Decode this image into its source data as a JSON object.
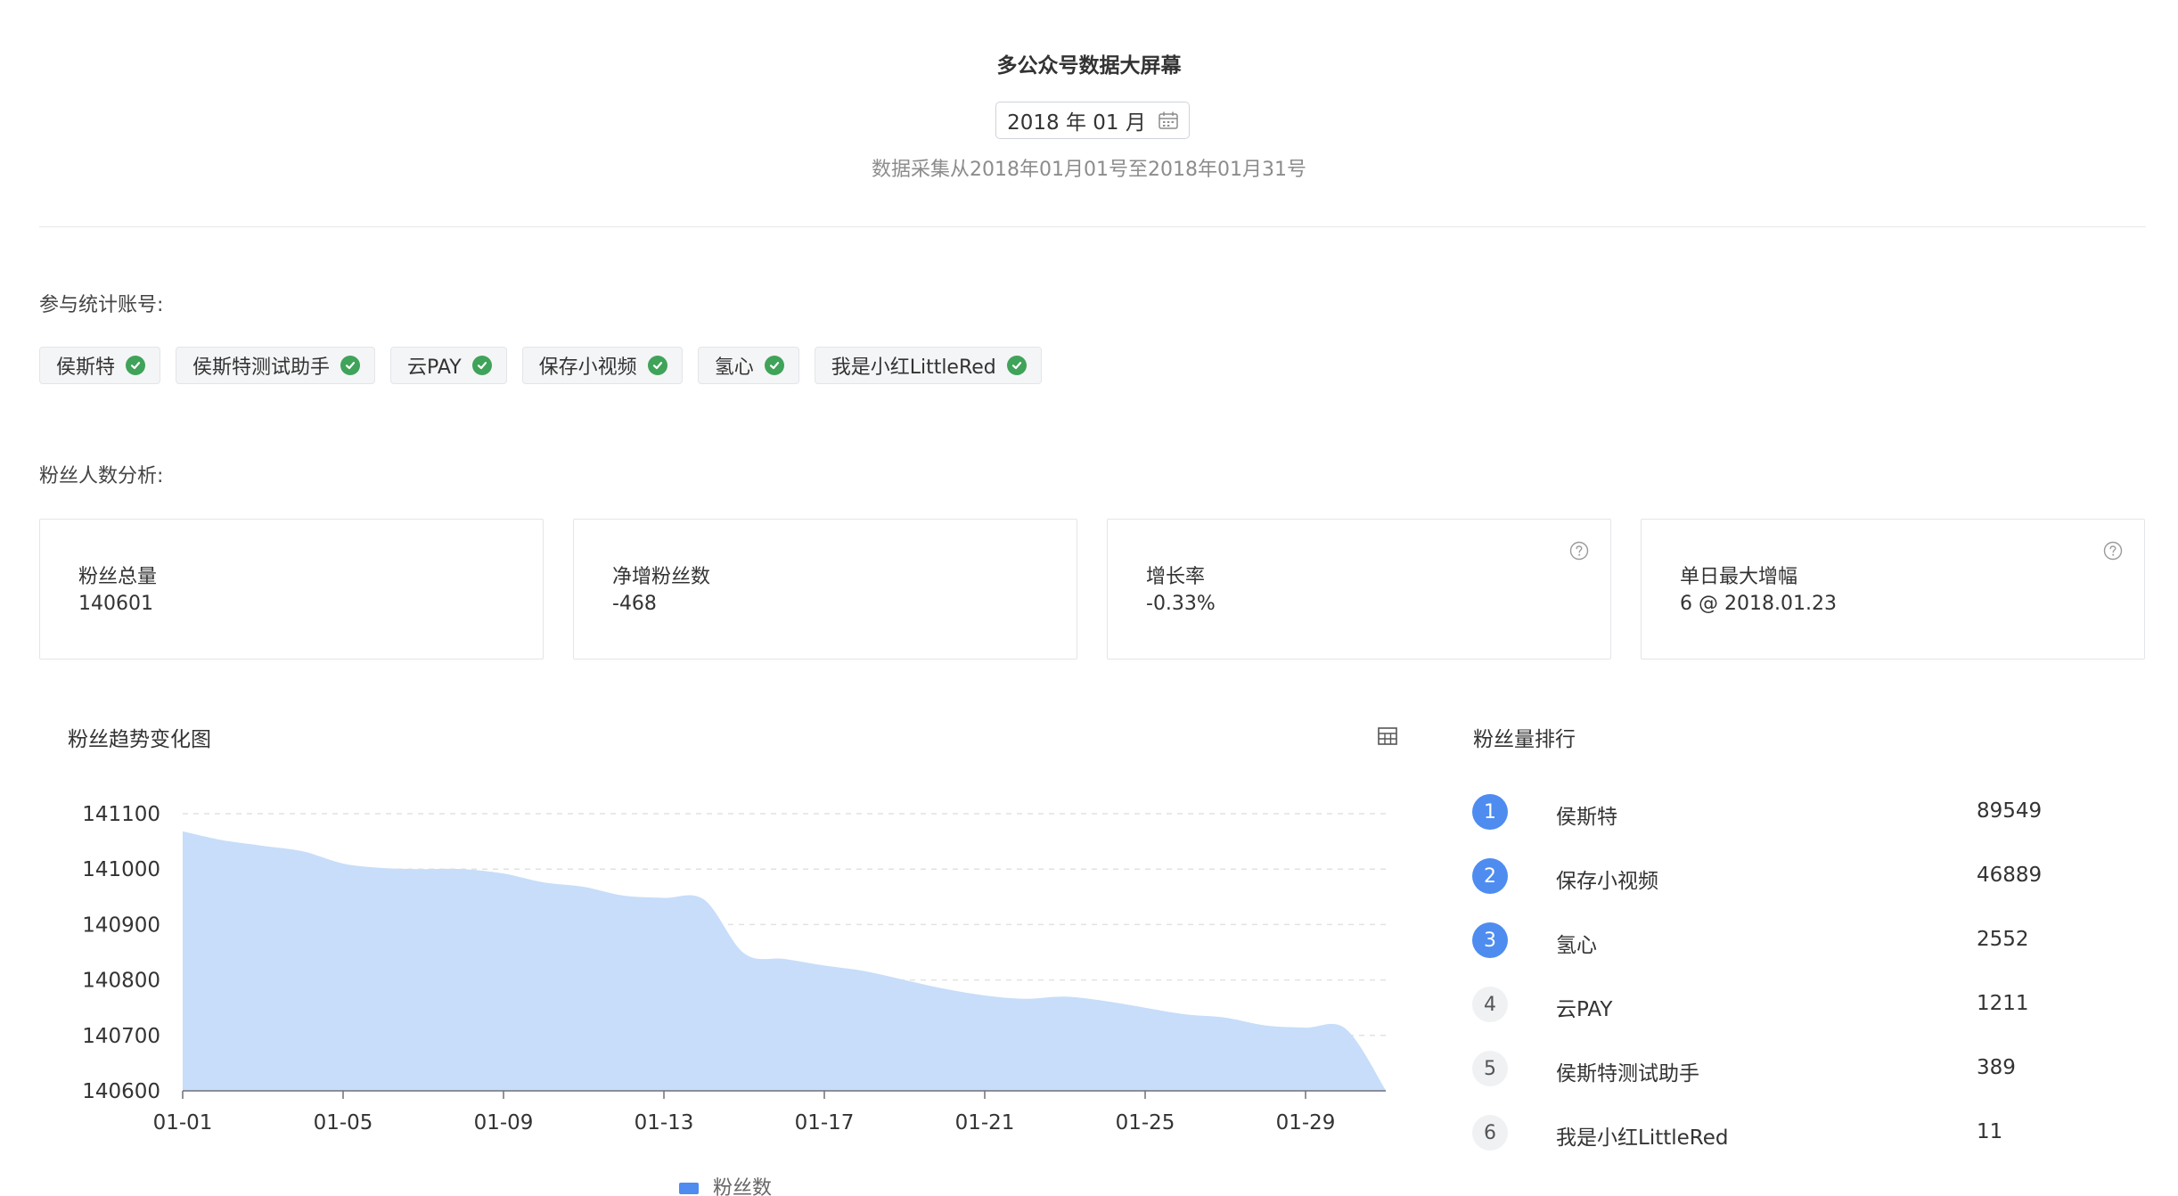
{
  "header": {
    "title": "多公众号数据大屏幕",
    "month_picker": "2018 年 01 月",
    "range_note": "数据采集从2018年01月01号至2018年01月31号"
  },
  "accounts": {
    "label": "参与统计账号:",
    "items": [
      "侯斯特",
      "侯斯特测试助手",
      "云PAY",
      "保存小视频",
      "氢心",
      "我是小红LittleRed"
    ]
  },
  "fans": {
    "label": "粉丝人数分析:",
    "cards": [
      {
        "label": "粉丝总量",
        "value": "140601",
        "help": false
      },
      {
        "label": "净增粉丝数",
        "value": "-468",
        "help": false
      },
      {
        "label": "增长率",
        "value": "-0.33%",
        "help": true
      },
      {
        "label": "单日最大增幅",
        "value": "6 @ 2018.01.23",
        "help": true
      }
    ]
  },
  "trend": {
    "title": "粉丝趋势变化图",
    "toggle_icon": "table-icon"
  },
  "chart_data": {
    "type": "area",
    "title": "粉丝趋势变化图",
    "xlabel": "",
    "ylabel": "",
    "x": [
      "01-01",
      "01-02",
      "01-03",
      "01-04",
      "01-05",
      "01-06",
      "01-07",
      "01-08",
      "01-09",
      "01-10",
      "01-11",
      "01-12",
      "01-13",
      "01-14",
      "01-15",
      "01-16",
      "01-17",
      "01-18",
      "01-19",
      "01-20",
      "01-21",
      "01-22",
      "01-23",
      "01-24",
      "01-25",
      "01-26",
      "01-27",
      "01-28",
      "01-29",
      "01-30",
      "01-31"
    ],
    "x_ticks": [
      "01-01",
      "01-05",
      "01-09",
      "01-13",
      "01-17",
      "01-21",
      "01-25",
      "01-29"
    ],
    "y_ticks": [
      140600,
      140700,
      140800,
      140900,
      141000,
      141100
    ],
    "ylim": [
      140600,
      141100
    ],
    "series": [
      {
        "name": "粉丝数",
        "color": "#c7ddf9",
        "values": [
          141068,
          141052,
          141042,
          141032,
          141010,
          141002,
          141000,
          141000,
          140992,
          140976,
          140968,
          140952,
          140948,
          140945,
          140848,
          140838,
          140826,
          140816,
          140800,
          140784,
          140772,
          140766,
          140770,
          140762,
          140750,
          140738,
          140732,
          140718,
          140714,
          140712,
          140601
        ]
      }
    ],
    "legend": "bottom",
    "grid": true
  },
  "ranking": {
    "title": "粉丝量排行",
    "items": [
      {
        "rank": "1",
        "name": "侯斯特",
        "value": "89549"
      },
      {
        "rank": "2",
        "name": "保存小视频",
        "value": "46889"
      },
      {
        "rank": "3",
        "name": "氢心",
        "value": "2552"
      },
      {
        "rank": "4",
        "name": "云PAY",
        "value": "1211"
      },
      {
        "rank": "5",
        "name": "侯斯特测试助手",
        "value": "389"
      },
      {
        "rank": "6",
        "name": "我是小红LittleRed",
        "value": "11"
      }
    ]
  },
  "colors": {
    "accent": "#4e8cf0",
    "check": "#3fa35a",
    "area_fill": "#c7ddf9"
  }
}
